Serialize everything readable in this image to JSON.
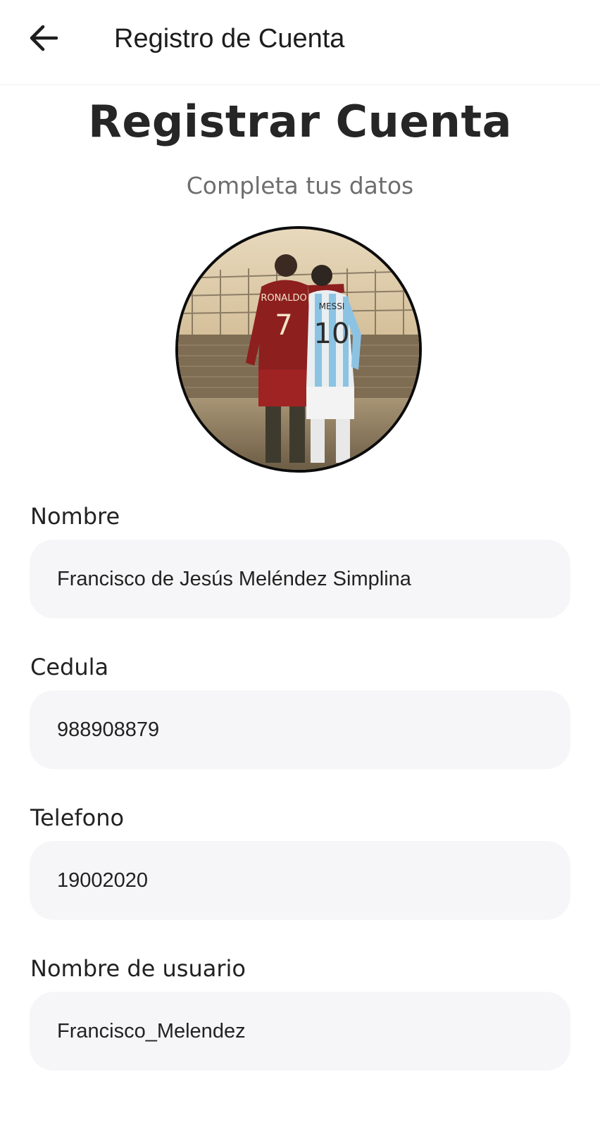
{
  "appbar": {
    "title": "Registro de Cuenta",
    "back_icon": "arrow-left-icon"
  },
  "header": {
    "title": "Registrar Cuenta",
    "subtitle": "Completa tus datos"
  },
  "avatar": {
    "jersey_left_name": "RONALDO",
    "jersey_left_number": "7",
    "jersey_right_name": "MESSI",
    "jersey_right_number": "10"
  },
  "form": {
    "fields": [
      {
        "label": "Nombre",
        "value": "Francisco de Jesús Meléndez Simplina"
      },
      {
        "label": "Cedula",
        "value": "988908879"
      },
      {
        "label": "Telefono",
        "value": "19002020"
      },
      {
        "label": "Nombre de usuario",
        "value": "Francisco_Melendez"
      }
    ]
  },
  "colors": {
    "background": "#ffffff",
    "input_background": "#f6f6f8",
    "title_text": "#262626",
    "subtitle_text": "#6e6e6e"
  }
}
